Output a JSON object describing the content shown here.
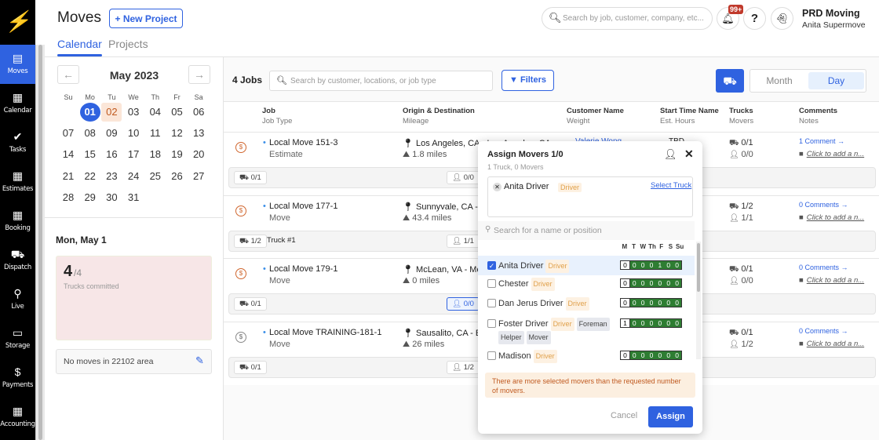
{
  "app": {
    "logo": "S",
    "title": "Moves",
    "new_project": "+ New Project",
    "tabs": [
      "Calendar",
      "Projects"
    ],
    "search_placeholder": "Search by job, customer, company, etc...",
    "notif_badge": "99+",
    "help": "?",
    "company": "PRD Moving",
    "user": "Anita Supermove"
  },
  "sidebar": {
    "items": [
      {
        "label": "Moves",
        "icon": "clipboard-icon",
        "glyph": "▤",
        "active": true
      },
      {
        "label": "Calendar",
        "icon": "calendar-icon",
        "glyph": "▦"
      },
      {
        "label": "Tasks",
        "icon": "check-circle-icon",
        "glyph": "✔"
      },
      {
        "label": "Estimates",
        "icon": "calendar-check-icon",
        "glyph": "▦"
      },
      {
        "label": "Booking",
        "icon": "calendar-check-icon",
        "glyph": "▦"
      },
      {
        "label": "Dispatch",
        "icon": "truck-icon",
        "glyph": "⛟"
      },
      {
        "label": "Live",
        "icon": "map-icon",
        "glyph": "⚲"
      },
      {
        "label": "Storage",
        "icon": "box-icon",
        "glyph": "▭"
      },
      {
        "label": "Payments",
        "icon": "dollar-icon",
        "glyph": "$"
      },
      {
        "label": "Accounting",
        "icon": "calculator-icon",
        "glyph": "▦"
      }
    ]
  },
  "calendar": {
    "month": "May 2023",
    "prev": "←",
    "next": "→",
    "dow": [
      "Su",
      "Mo",
      "Tu",
      "We",
      "Th",
      "Fr",
      "Sa"
    ],
    "weeks": [
      [
        "",
        "01",
        "02",
        "03",
        "04",
        "05",
        "06"
      ],
      [
        "07",
        "08",
        "09",
        "10",
        "11",
        "12",
        "13"
      ],
      [
        "14",
        "15",
        "16",
        "17",
        "18",
        "19",
        "20"
      ],
      [
        "21",
        "22",
        "23",
        "24",
        "25",
        "26",
        "27"
      ],
      [
        "28",
        "29",
        "30",
        "31",
        "",
        "",
        ""
      ]
    ],
    "selected": "01",
    "today": "02"
  },
  "day_summary": {
    "date": "Mon, May 1",
    "committed": "4",
    "total": "/4",
    "committed_label": "Trucks committed",
    "area_text": "No moves in 22102 area"
  },
  "toolbar": {
    "jobs_count": "4 Jobs",
    "search_placeholder": "Search by customer, locations, or job type",
    "filters": "Filters",
    "view_month": "Month",
    "view_day": "Day",
    "active_view": "Day"
  },
  "columns": [
    {
      "h": "Job",
      "s": "Job Type"
    },
    {
      "h": "Origin & Destination",
      "s": "Mileage"
    },
    {
      "h": "Customer Name",
      "s": "Weight"
    },
    {
      "h": "Start Time Name",
      "s": "Est. Hours"
    },
    {
      "h": "Trucks",
      "s": "Movers"
    },
    {
      "h": "Comments",
      "s": "Notes"
    }
  ],
  "jobs": [
    {
      "name": "Local Move 151-3",
      "type": "Estimate",
      "origin": "Los Angeles, CA - Los Angeles, CA",
      "miles": "1.8 miles",
      "customer": "Valerie Wong",
      "start": "TBD",
      "trucks": "0/1",
      "movers": "0/0",
      "comments": "1 Comment",
      "notes": "Click to add a n...",
      "chip_trucks": "0/1",
      "chip_truck_name": "",
      "chip_movers": "0/0",
      "paid": false
    },
    {
      "name": "Local Move 177-1",
      "type": "Move",
      "origin": "Sunnyvale, CA - Oakland, CA",
      "miles": "43.4 miles",
      "trucks": "1/2",
      "movers": "1/1",
      "comments": "0 Comments",
      "notes": "Click to add a n...",
      "chip_trucks": "1/2",
      "chip_truck_name": "Truck #1",
      "chip_movers": "1/1",
      "paid": false
    },
    {
      "name": "Local Move 179-1",
      "type": "Move",
      "origin": "McLean, VA - McLean, VA",
      "miles": "0 miles",
      "trucks": "0/1",
      "movers": "0/0",
      "comments": "0 Comments",
      "notes": "Click to add a n...",
      "chip_trucks": "0/1",
      "chip_truck_name": "",
      "chip_movers": "0/0",
      "paid": false,
      "active": true
    },
    {
      "name": "Local Move TRAINING-181-1",
      "type": "Move",
      "origin": "Sausalito, CA - Emeryville, CA",
      "miles": "26 miles",
      "trucks": "0/1",
      "movers": "1/2",
      "comments": "0 Comments",
      "notes": "Click to add a n...",
      "chip_trucks": "0/1",
      "chip_truck_name": "",
      "chip_movers": "1/2",
      "paid": true
    }
  ],
  "assign": {
    "title": "Assign Movers 1/0",
    "subtitle": "1 Truck, 0 Movers",
    "selected_name": "Anita Driver",
    "selected_role": "Driver",
    "select_truck": "Select Truck",
    "search_placeholder": "Search for a name or position",
    "days": [
      "M",
      "T",
      "W",
      "Th",
      "F",
      "S",
      "Su"
    ],
    "movers": [
      {
        "name": "Anita Driver",
        "roles": [
          "Driver"
        ],
        "checked": true,
        "sched": [
          "0",
          "0",
          "0",
          "0",
          "1",
          "0",
          "0"
        ]
      },
      {
        "name": "Chester",
        "roles": [
          "Driver"
        ],
        "checked": false,
        "sched": [
          "0",
          "0",
          "0",
          "0",
          "0",
          "0",
          "0"
        ]
      },
      {
        "name": "Dan Jerus Driver",
        "roles": [
          "Driver"
        ],
        "checked": false,
        "sched": [
          "0",
          "0",
          "0",
          "0",
          "0",
          "0",
          "0"
        ]
      },
      {
        "name": "Foster Driver",
        "roles": [
          "Driver",
          "Foreman",
          "Helper",
          "Mover"
        ],
        "checked": false,
        "sched": [
          "1",
          "0",
          "0",
          "0",
          "0",
          "0",
          "0"
        ]
      },
      {
        "name": "Madison",
        "roles": [
          "Driver"
        ],
        "checked": false,
        "sched": [
          "0",
          "0",
          "0",
          "0",
          "0",
          "0",
          "0"
        ]
      }
    ],
    "warning": "There are more selected movers than the requested number of movers.",
    "cancel": "Cancel",
    "assign": "Assign"
  }
}
